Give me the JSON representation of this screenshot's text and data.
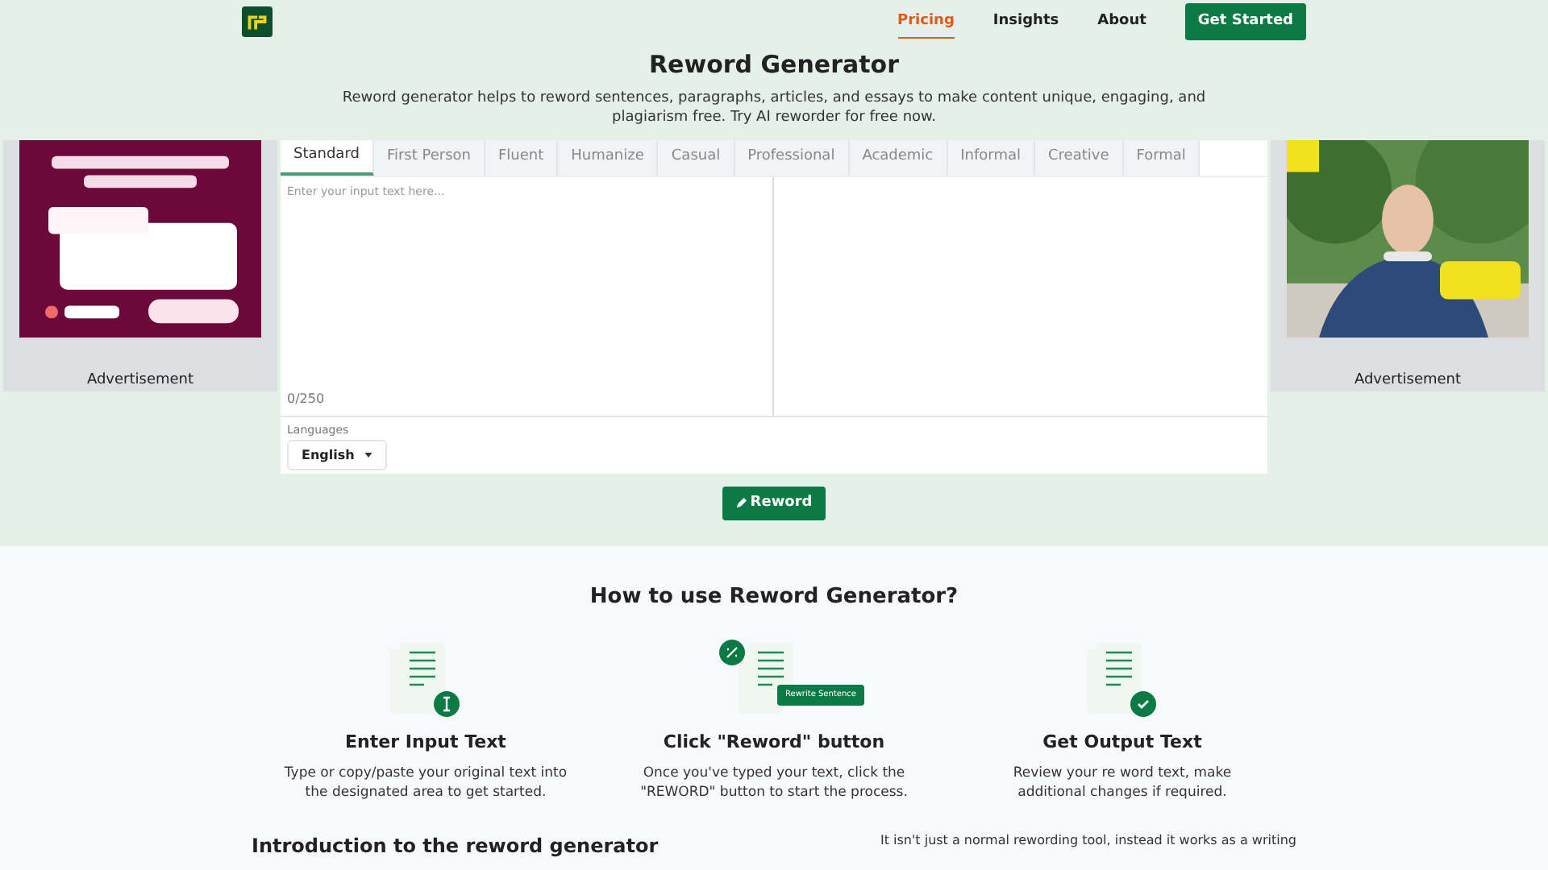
{
  "nav": {
    "items": [
      {
        "label": "Pricing",
        "selected": true
      },
      {
        "label": "Insights",
        "selected": false
      },
      {
        "label": "About",
        "selected": false
      }
    ],
    "cta": "Get Started"
  },
  "hero": {
    "title": "Reword Generator",
    "description": "Reword generator helps to reword sentences, paragraphs, articles, and essays to make content unique, engaging, and plagiarism free. Try AI reworder for free now."
  },
  "ads": [
    {
      "label": "Advertisement"
    },
    {
      "label": "Advertisement"
    }
  ],
  "tabs": [
    {
      "label": "Standard",
      "selected": true
    },
    {
      "label": "First Person",
      "selected": false
    },
    {
      "label": "Fluent",
      "selected": false
    },
    {
      "label": "Humanize",
      "selected": false
    },
    {
      "label": "Casual",
      "selected": false
    },
    {
      "label": "Professional",
      "selected": false
    },
    {
      "label": "Academic",
      "selected": false
    },
    {
      "label": "Informal",
      "selected": false
    },
    {
      "label": "Creative",
      "selected": false
    },
    {
      "label": "Formal",
      "selected": false
    }
  ],
  "input": {
    "placeholder": "Enter your input text here...",
    "counter": "0/250"
  },
  "languages": {
    "label": "Languages",
    "value": "English"
  },
  "reword_button": "Reword",
  "how_to": {
    "title": "How to use Reword Generator?",
    "steps": [
      {
        "kind": "input",
        "title": "Enter Input Text",
        "text": "Type or copy/paste your original text into the designated area to get started."
      },
      {
        "kind": "click",
        "title": "Click \"Reword\" button",
        "text": "Once you've typed your text, click the \"REWORD\" button to start the process.",
        "badge": "Rewrite Sentence"
      },
      {
        "kind": "output",
        "title": "Get Output Text",
        "text": "Review your re word text, make additional changes if required."
      }
    ]
  },
  "intro": {
    "title": "Introduction to the reword generator",
    "text": "It isn't just a normal rewording tool, instead it works as a writing"
  }
}
